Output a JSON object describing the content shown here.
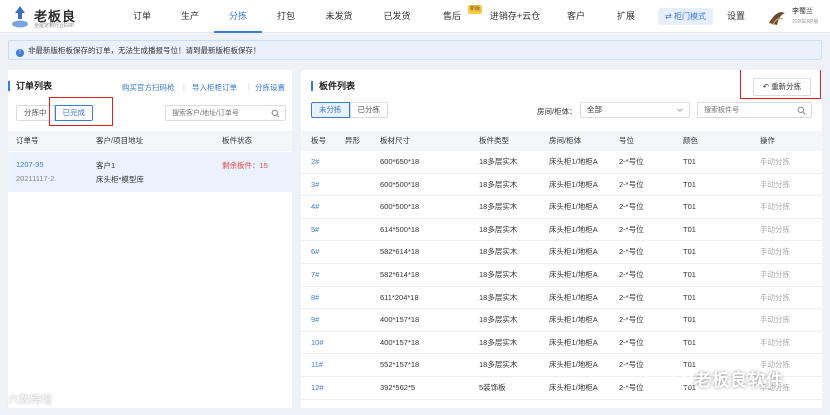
{
  "brand": {
    "name": "老板良",
    "tagline": "全屋定制行业ERP"
  },
  "nav": {
    "items": [
      {
        "label": "订单"
      },
      {
        "label": "生产"
      },
      {
        "label": "分拣",
        "active": true
      },
      {
        "label": "打包"
      },
      {
        "label": "未发货"
      },
      {
        "label": "已发货"
      },
      {
        "label": "售后",
        "badge": "新版"
      },
      {
        "label": "进销存+云仓"
      },
      {
        "label": "客户"
      },
      {
        "label": "扩展"
      }
    ],
    "mode_button": "柜门模式",
    "settings": "设置",
    "user_name": "李蜀兰",
    "user_sub": "2020ERP版"
  },
  "notice": {
    "icon": "info-icon",
    "text": "非最新版柜板保存的订单，无法生成播报号位！请到最新版柜板保存！"
  },
  "orders": {
    "title": "订单列表",
    "links": [
      "购买官方扫码枪",
      "导入柜柜订单",
      "分拣设置"
    ],
    "tabs": [
      "分拣中",
      "已完成"
    ],
    "search_placeholder": "搜索客户/地址/订单号",
    "columns": [
      "订单号",
      "客户/项目地址",
      "板件状态"
    ],
    "rows": [
      {
        "order_no": "1207-35",
        "date": "20211117-2",
        "customer": "客户1",
        "address": "床头柜*模型库",
        "status": "剩余板件：15"
      }
    ]
  },
  "boards": {
    "title": "板件列表",
    "regen_button": "重新分拣",
    "tabs": [
      "未分拣",
      "已分拣"
    ],
    "filter_label": "房间/柜体：",
    "filter_value": "全部",
    "search_placeholder": "搜索板件号",
    "columns": [
      "板号",
      "异形",
      "板材尺寸",
      "板件类型",
      "房间/柜体",
      "号位",
      "颜色",
      "操作"
    ],
    "rows": [
      {
        "no": "2#",
        "size": "600*650*18",
        "type": "18多层实木",
        "room": "床头柜1/地柜A",
        "slot": "2-*号位",
        "color": "T01",
        "action": "手动分拣"
      },
      {
        "no": "3#",
        "size": "600*500*18",
        "type": "18多层实木",
        "room": "床头柜1/地柜A",
        "slot": "2-*号位",
        "color": "T01",
        "action": "手动分拣"
      },
      {
        "no": "4#",
        "size": "600*500*18",
        "type": "18多层实木",
        "room": "床头柜1/地柜A",
        "slot": "2-*号位",
        "color": "T01",
        "action": "手动分拣"
      },
      {
        "no": "5#",
        "size": "614*500*18",
        "type": "18多层实木",
        "room": "床头柜1/地柜A",
        "slot": "2-*号位",
        "color": "T01",
        "action": "手动分拣"
      },
      {
        "no": "6#",
        "size": "582*614*18",
        "type": "18多层实木",
        "room": "床头柜1/地柜A",
        "slot": "2-*号位",
        "color": "T01",
        "action": "手动分拣"
      },
      {
        "no": "7#",
        "size": "582*614*18",
        "type": "18多层实木",
        "room": "床头柜1/地柜A",
        "slot": "2-*号位",
        "color": "T01",
        "action": "手动分拣"
      },
      {
        "no": "8#",
        "size": "611*204*18",
        "type": "18多层实木",
        "room": "床头柜1/地柜A",
        "slot": "2-*号位",
        "color": "T01",
        "action": "手动分拣"
      },
      {
        "no": "9#",
        "size": "400*157*18",
        "type": "18多层实木",
        "room": "床头柜1/地柜A",
        "slot": "2-*号位",
        "color": "T01",
        "action": "手动分拣"
      },
      {
        "no": "10#",
        "size": "400*157*18",
        "type": "18多层实木",
        "room": "床头柜1/地柜A",
        "slot": "2-*号位",
        "color": "T01",
        "action": "手动分拣"
      },
      {
        "no": "11#",
        "size": "552*157*18",
        "type": "18多层实木",
        "room": "床头柜1/地柜A",
        "slot": "2-*号位",
        "color": "T01",
        "action": "手动分拣"
      },
      {
        "no": "12#",
        "size": "392*562*5",
        "type": "5装饰板",
        "room": "床头柜1/地柜A",
        "slot": "2-*号位",
        "color": "T01",
        "action": "手动分拣"
      }
    ]
  },
  "watermarks": {
    "left": "六数跨境",
    "right": "老板良软件"
  },
  "colors": {
    "accent": "#3a7bd5",
    "danger": "#e02020",
    "status_red": "#e84a4a"
  }
}
